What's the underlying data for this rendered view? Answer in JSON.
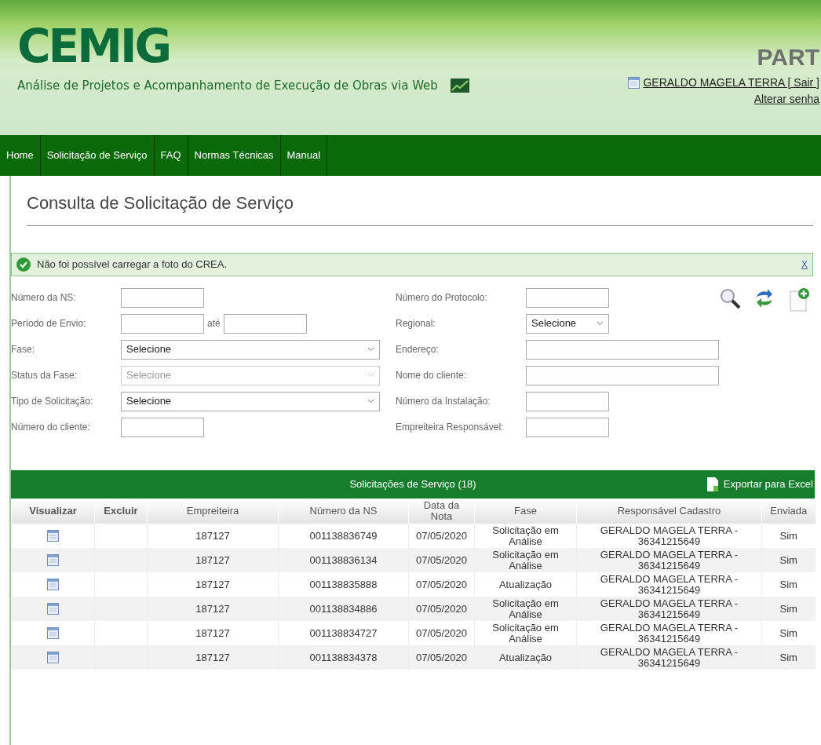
{
  "header": {
    "logo": "CEMIG",
    "subtitle": "Análise de Projetos e Acompanhamento de Execução de Obras via Web",
    "product": "PART",
    "user": "GERALDO MAGELA TERRA",
    "logout": "[ Sair ]",
    "change_password": "Alterar senha"
  },
  "nav": [
    {
      "label": "Home"
    },
    {
      "label": "Solicitação de Serviço"
    },
    {
      "label": "FAQ"
    },
    {
      "label": "Normas Técnicas"
    },
    {
      "label": "Manual"
    }
  ],
  "page_title": "Consulta de Solicitação de Serviço",
  "alert": {
    "message": "Não foi possível carregar a foto do CREA.",
    "close": "X"
  },
  "form": {
    "left": [
      {
        "label": "Número da NS:",
        "kind": "text",
        "disabled": false
      },
      {
        "label": "Período de Envio:",
        "kind": "range",
        "between": "até",
        "disabled": false
      },
      {
        "label": "Fase:",
        "kind": "select",
        "value": "Selecione",
        "disabled": false
      },
      {
        "label": "Status da Fase:",
        "kind": "select",
        "value": "Selecione",
        "disabled": true
      },
      {
        "label": "Tipo de Solicitação:",
        "kind": "select",
        "value": "Selecione",
        "disabled": false
      },
      {
        "label": "Número do cliente:",
        "kind": "text",
        "disabled": false
      }
    ],
    "right": [
      {
        "label": "Número do Protocolo:",
        "kind": "text",
        "disabled": false
      },
      {
        "label": "Regional:",
        "kind": "select",
        "value": "Selecione",
        "disabled": false
      },
      {
        "label": "Endereço:",
        "kind": "text",
        "disabled": false
      },
      {
        "label": "Nome do cliente:",
        "kind": "text",
        "disabled": false
      },
      {
        "label": "Número da Instalação:",
        "kind": "text",
        "disabled": false
      },
      {
        "label": "Empreiteira Responsável:",
        "kind": "text",
        "disabled": false
      }
    ]
  },
  "table": {
    "title": "Solicitações de Serviço (18)",
    "export": "Exportar para Excel",
    "columns": [
      "Visualizar",
      "Excluir",
      "Empreiteira",
      "Número da NS",
      "Data da Nota",
      "Fase",
      "Responsável Cadastro",
      "Enviada"
    ],
    "rows": [
      {
        "empreiteira": "187127",
        "numero_ns": "001138836749",
        "data": "07/05/2020",
        "fase": "Solicitação em Análise",
        "responsavel": "GERALDO MAGELA TERRA - 36341215649",
        "enviada": "Sim"
      },
      {
        "empreiteira": "187127",
        "numero_ns": "001138836134",
        "data": "07/05/2020",
        "fase": "Solicitação em Análise",
        "responsavel": "GERALDO MAGELA TERRA - 36341215649",
        "enviada": "Sim"
      },
      {
        "empreiteira": "187127",
        "numero_ns": "001138835888",
        "data": "07/05/2020",
        "fase": "Atualização",
        "responsavel": "GERALDO MAGELA TERRA - 36341215649",
        "enviada": "Sim"
      },
      {
        "empreiteira": "187127",
        "numero_ns": "001138834886",
        "data": "07/05/2020",
        "fase": "Solicitação em Análise",
        "responsavel": "GERALDO MAGELA TERRA - 36341215649",
        "enviada": "Sim"
      },
      {
        "empreiteira": "187127",
        "numero_ns": "001138834727",
        "data": "07/05/2020",
        "fase": "Solicitação em Análise",
        "responsavel": "GERALDO MAGELA TERRA - 36341215649",
        "enviada": "Sim"
      },
      {
        "empreiteira": "187127",
        "numero_ns": "001138834378",
        "data": "07/05/2020",
        "fase": "Atualização",
        "responsavel": "GERALDO MAGELA TERRA - 36341215649",
        "enviada": "Sim"
      }
    ]
  }
}
